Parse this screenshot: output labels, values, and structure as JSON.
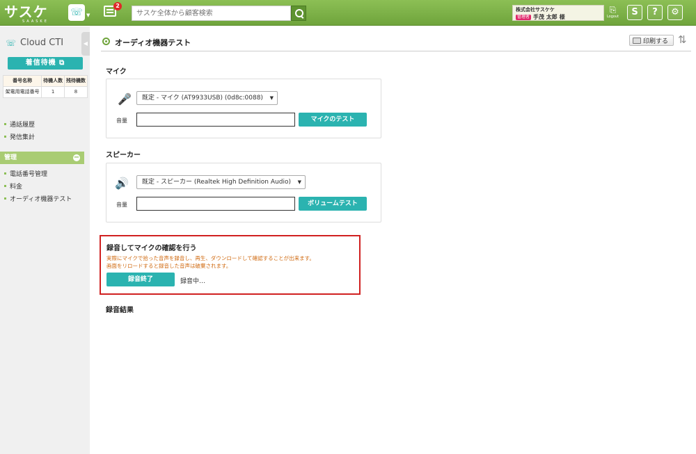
{
  "topbar": {
    "logo_text": "サスケ",
    "logo_sub": "SAASKE",
    "phone_icon": "phone-icon",
    "message_badge": "2",
    "search_placeholder": "サスケ全体から顧客検索",
    "user": {
      "company": "株式会社サスケケ",
      "role": "管理者",
      "name": "手茂 太郎 様"
    },
    "logout_label": "Logout",
    "colors": {
      "bar": "#7cb248",
      "accent": "#2bb3b0"
    }
  },
  "sidebar": {
    "title": "Cloud CTI",
    "incoming_button": "着信待機",
    "table": {
      "headers": [
        "番号名称",
        "待機人数",
        "残待機数"
      ],
      "rows": [
        [
          "架電用電話番号",
          "1",
          "8"
        ]
      ]
    },
    "links": [
      "通話履歴",
      "発信集計"
    ],
    "section_title": "管理",
    "management_links": [
      "電話番号管理",
      "料金",
      "オーディオ機器テスト"
    ]
  },
  "main": {
    "page_title": "オーディオ機器テスト",
    "print_label": "印刷する",
    "mic": {
      "label": "マイク",
      "selected_device": "既定 - マイク (AT9933USB) (0d8c:0088)",
      "volume_label": "音量",
      "test_button": "マイクのテスト"
    },
    "speaker": {
      "label": "スピーカー",
      "selected_device": "既定 - スピーカー (Realtek High Definition Audio)",
      "volume_label": "音量",
      "test_button": "ボリュームテスト"
    },
    "recording": {
      "title": "録音してマイクの確認を行う",
      "desc_line1": "実際にマイクで拾った音声を録音し、再生、ダウンロードして確認することが出来ます。",
      "desc_line2": "画面をリロードすると録音した音声は破棄されます。",
      "stop_button": "録音終了",
      "status": "録音中…"
    },
    "result_label": "録音結果"
  }
}
